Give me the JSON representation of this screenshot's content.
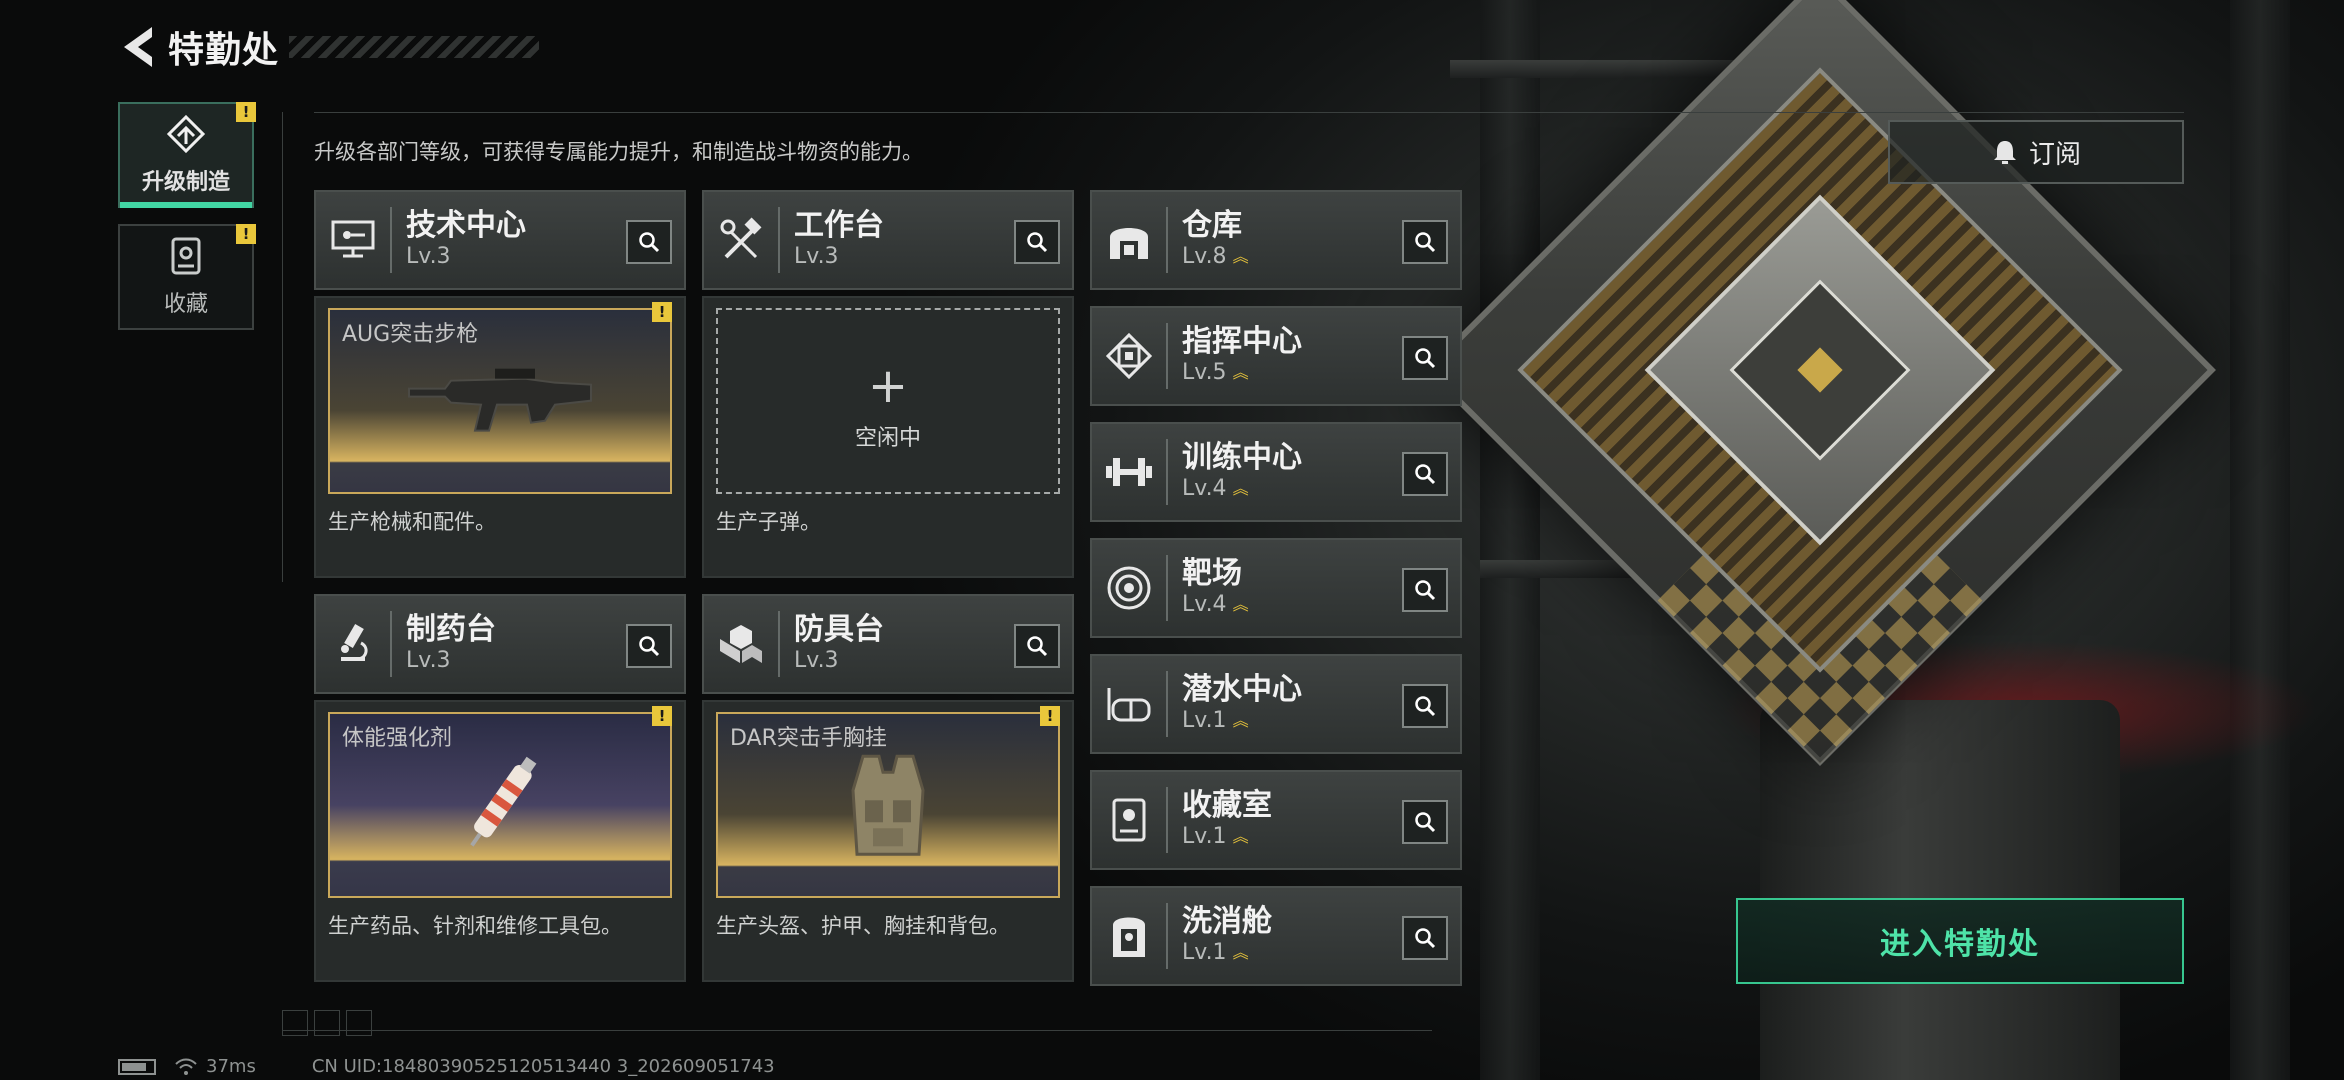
{
  "header": {
    "title": "特勤处"
  },
  "side_tabs": [
    {
      "label": "升级制造",
      "active": true,
      "alert": "!"
    },
    {
      "label": "收藏",
      "active": false,
      "alert": "!"
    }
  ],
  "intro": "升级各部门等级，可获得专属能力提升，和制造战斗物资的能力。",
  "subscribe_label": "订阅",
  "production": [
    {
      "name": "技术中心",
      "level": "Lv.3",
      "item": "AUG突击步枪",
      "desc": "生产枪械和配件。",
      "alert": "!"
    },
    {
      "name": "工作台",
      "level": "Lv.3",
      "idle": "空闲中",
      "plus": "+",
      "desc": "生产子弹。"
    },
    {
      "name": "制药台",
      "level": "Lv.3",
      "item": "体能强化剂",
      "desc": "生产药品、针剂和维修工具包。",
      "alert": "!"
    },
    {
      "name": "防具台",
      "level": "Lv.3",
      "item": "DAR突击手胸挂",
      "desc": "生产头盔、护甲、胸挂和背包。",
      "alert": "!"
    }
  ],
  "facilities": [
    {
      "name": "仓库",
      "level": "Lv.8",
      "icon": "warehouse-icon"
    },
    {
      "name": "指挥中心",
      "level": "Lv.5",
      "icon": "chip-icon"
    },
    {
      "name": "训练中心",
      "level": "Lv.4",
      "icon": "dumbbell-icon"
    },
    {
      "name": "靶场",
      "level": "Lv.4",
      "icon": "target-icon"
    },
    {
      "name": "潜水中心",
      "level": "Lv.1",
      "icon": "diving-mask-icon"
    },
    {
      "name": "收藏室",
      "level": "Lv.1",
      "icon": "collection-icon"
    },
    {
      "name": "洗消舱",
      "level": "Lv.1",
      "icon": "decon-icon"
    }
  ],
  "enter_label": "进入特勤处",
  "footer": {
    "ping": "37ms",
    "uid": "CN UID:18480390525120513440 3_202609051743"
  },
  "colors": {
    "accent": "#42d6a4",
    "alert": "#e9c73b",
    "gold": "#c9a85a"
  }
}
